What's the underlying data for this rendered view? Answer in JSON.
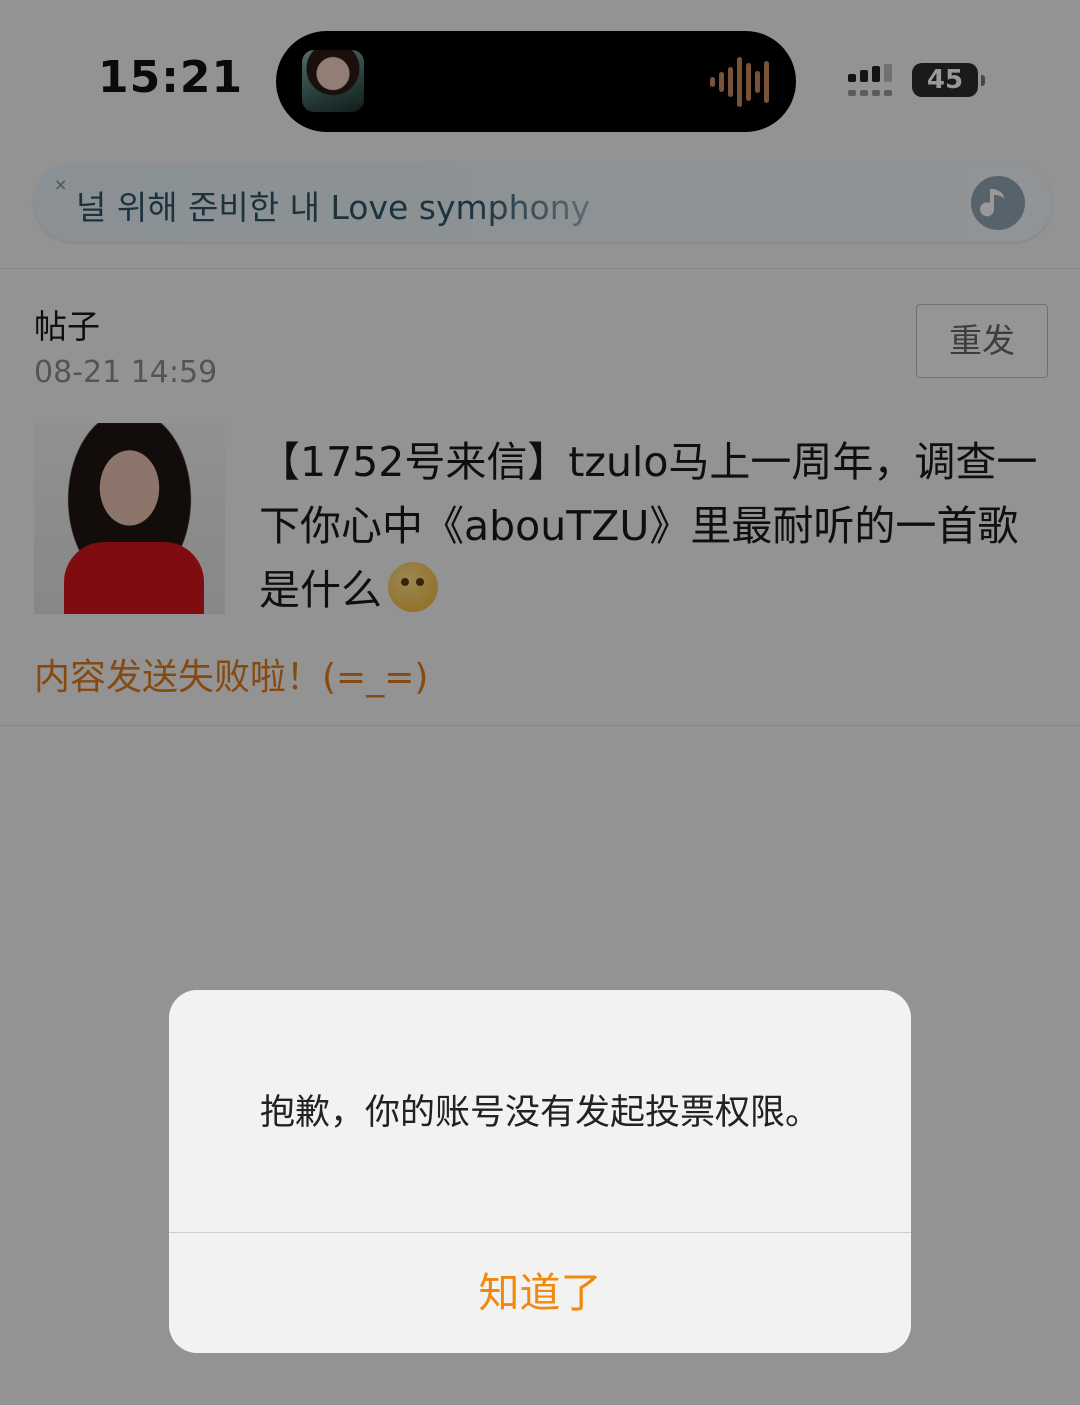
{
  "status_bar": {
    "time": "15:21",
    "battery_level": "45"
  },
  "lyric_bar": {
    "text": "널 위해 준비한 내 Love symphony",
    "close_glyph": "×"
  },
  "post": {
    "type_label": "帖子",
    "timestamp": "08-21 14:59",
    "resend_label": "重发",
    "body_text": "【1752号来信】tzulo马上一周年，调查一下你心中《abouTZU》里最耐听的一首歌是什么",
    "fail_message": "内容发送失败啦！(=_=)"
  },
  "dialog": {
    "message": "抱歉，你的账号没有发起投票权限。",
    "confirm_label": "知道了"
  },
  "colors": {
    "accent_orange": "#f08a0c",
    "fail_orange": "#e07b1a",
    "overlay": "rgba(0,0,0,0.40)"
  }
}
